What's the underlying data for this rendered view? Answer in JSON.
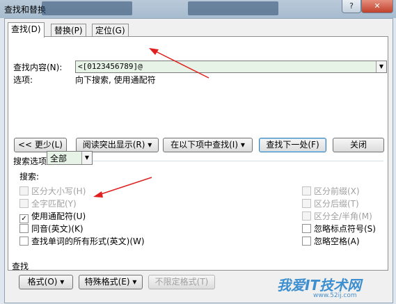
{
  "window": {
    "title": "查找和替换",
    "help_label": "?",
    "close_label": "✕"
  },
  "tabs": [
    {
      "label": "查找(D)",
      "active": true
    },
    {
      "label": "替换(P)",
      "active": false
    },
    {
      "label": "定位(G)",
      "active": false
    }
  ],
  "find": {
    "label": "查找内容(N):",
    "value": "<[0123456789]@",
    "options_label": "选项:",
    "options_value": "向下搜索, 使用通配符"
  },
  "buttons": {
    "less": "<< 更少(L)",
    "reading_highlight": "阅读突出显示(R) ▾",
    "find_in": "在以下项中查找(I) ▾",
    "find_next": "查找下一处(F)",
    "close": "关闭"
  },
  "search_options": {
    "section_label": "搜索选项",
    "search_label": "搜索:",
    "search_value": "全部",
    "left": [
      {
        "label": "区分大小写(H)",
        "checked": false,
        "disabled": true
      },
      {
        "label": "全字匹配(Y)",
        "checked": false,
        "disabled": true
      },
      {
        "label": "使用通配符(U)",
        "checked": true,
        "disabled": false
      },
      {
        "label": "同音(英文)(K)",
        "checked": false,
        "disabled": false
      },
      {
        "label": "查找单词的所有形式(英文)(W)",
        "checked": false,
        "disabled": false
      }
    ],
    "right": [
      {
        "label": "区分前缀(X)",
        "checked": false,
        "disabled": true
      },
      {
        "label": "区分后缀(T)",
        "checked": false,
        "disabled": true
      },
      {
        "label": "区分全/半角(M)",
        "checked": false,
        "disabled": true
      },
      {
        "label": "忽略标点符号(S)",
        "checked": false,
        "disabled": false
      },
      {
        "label": "忽略空格(A)",
        "checked": false,
        "disabled": false
      }
    ]
  },
  "find_section": {
    "label": "查找",
    "format": "格式(O) ▾",
    "special": "特殊格式(E) ▾",
    "no_format": "不限定格式(T)"
  },
  "watermark": {
    "text": "我爱IT技术网",
    "url": "www.52ij.com"
  },
  "colors": {
    "accent": "#3c7fb1",
    "field_bg": "#e7f3e7",
    "arrow": "#e02020"
  }
}
